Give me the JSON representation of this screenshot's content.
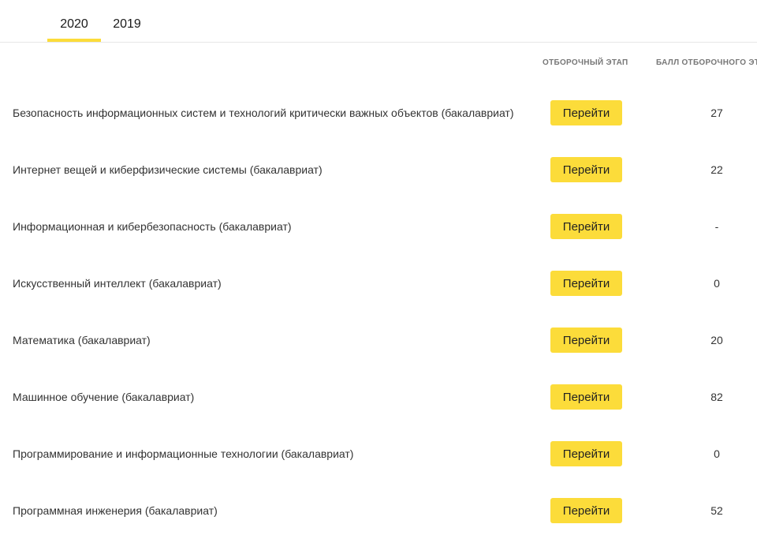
{
  "tabs": [
    {
      "label": "2020",
      "active": true
    },
    {
      "label": "2019",
      "active": false
    }
  ],
  "accent_color": "#fcdc3a",
  "columns": {
    "stage": "ОТБОРОЧНЫЙ ЭТАП",
    "score": "БАЛЛ ОТБОРОЧНОГО ЭТАПА"
  },
  "rows": [
    {
      "title": "Безопасность информационных систем и технологий критически важных объектов (бакалавриат)",
      "button": "Перейти",
      "score": "27"
    },
    {
      "title": "Интернет вещей и киберфизические системы (бакалавриат)",
      "button": "Перейти",
      "score": "22"
    },
    {
      "title": "Информационная и кибербезопасность (бакалавриат)",
      "button": "Перейти",
      "score": "-"
    },
    {
      "title": "Искусственный интеллект (бакалавриат)",
      "button": "Перейти",
      "score": "0"
    },
    {
      "title": "Математика (бакалавриат)",
      "button": "Перейти",
      "score": "20"
    },
    {
      "title": "Машинное обучение (бакалавриат)",
      "button": "Перейти",
      "score": "82"
    },
    {
      "title": "Программирование и информационные технологии (бакалавриат)",
      "button": "Перейти",
      "score": "0"
    },
    {
      "title": "Программная инженерия (бакалавриат)",
      "button": "Перейти",
      "score": "52"
    }
  ]
}
